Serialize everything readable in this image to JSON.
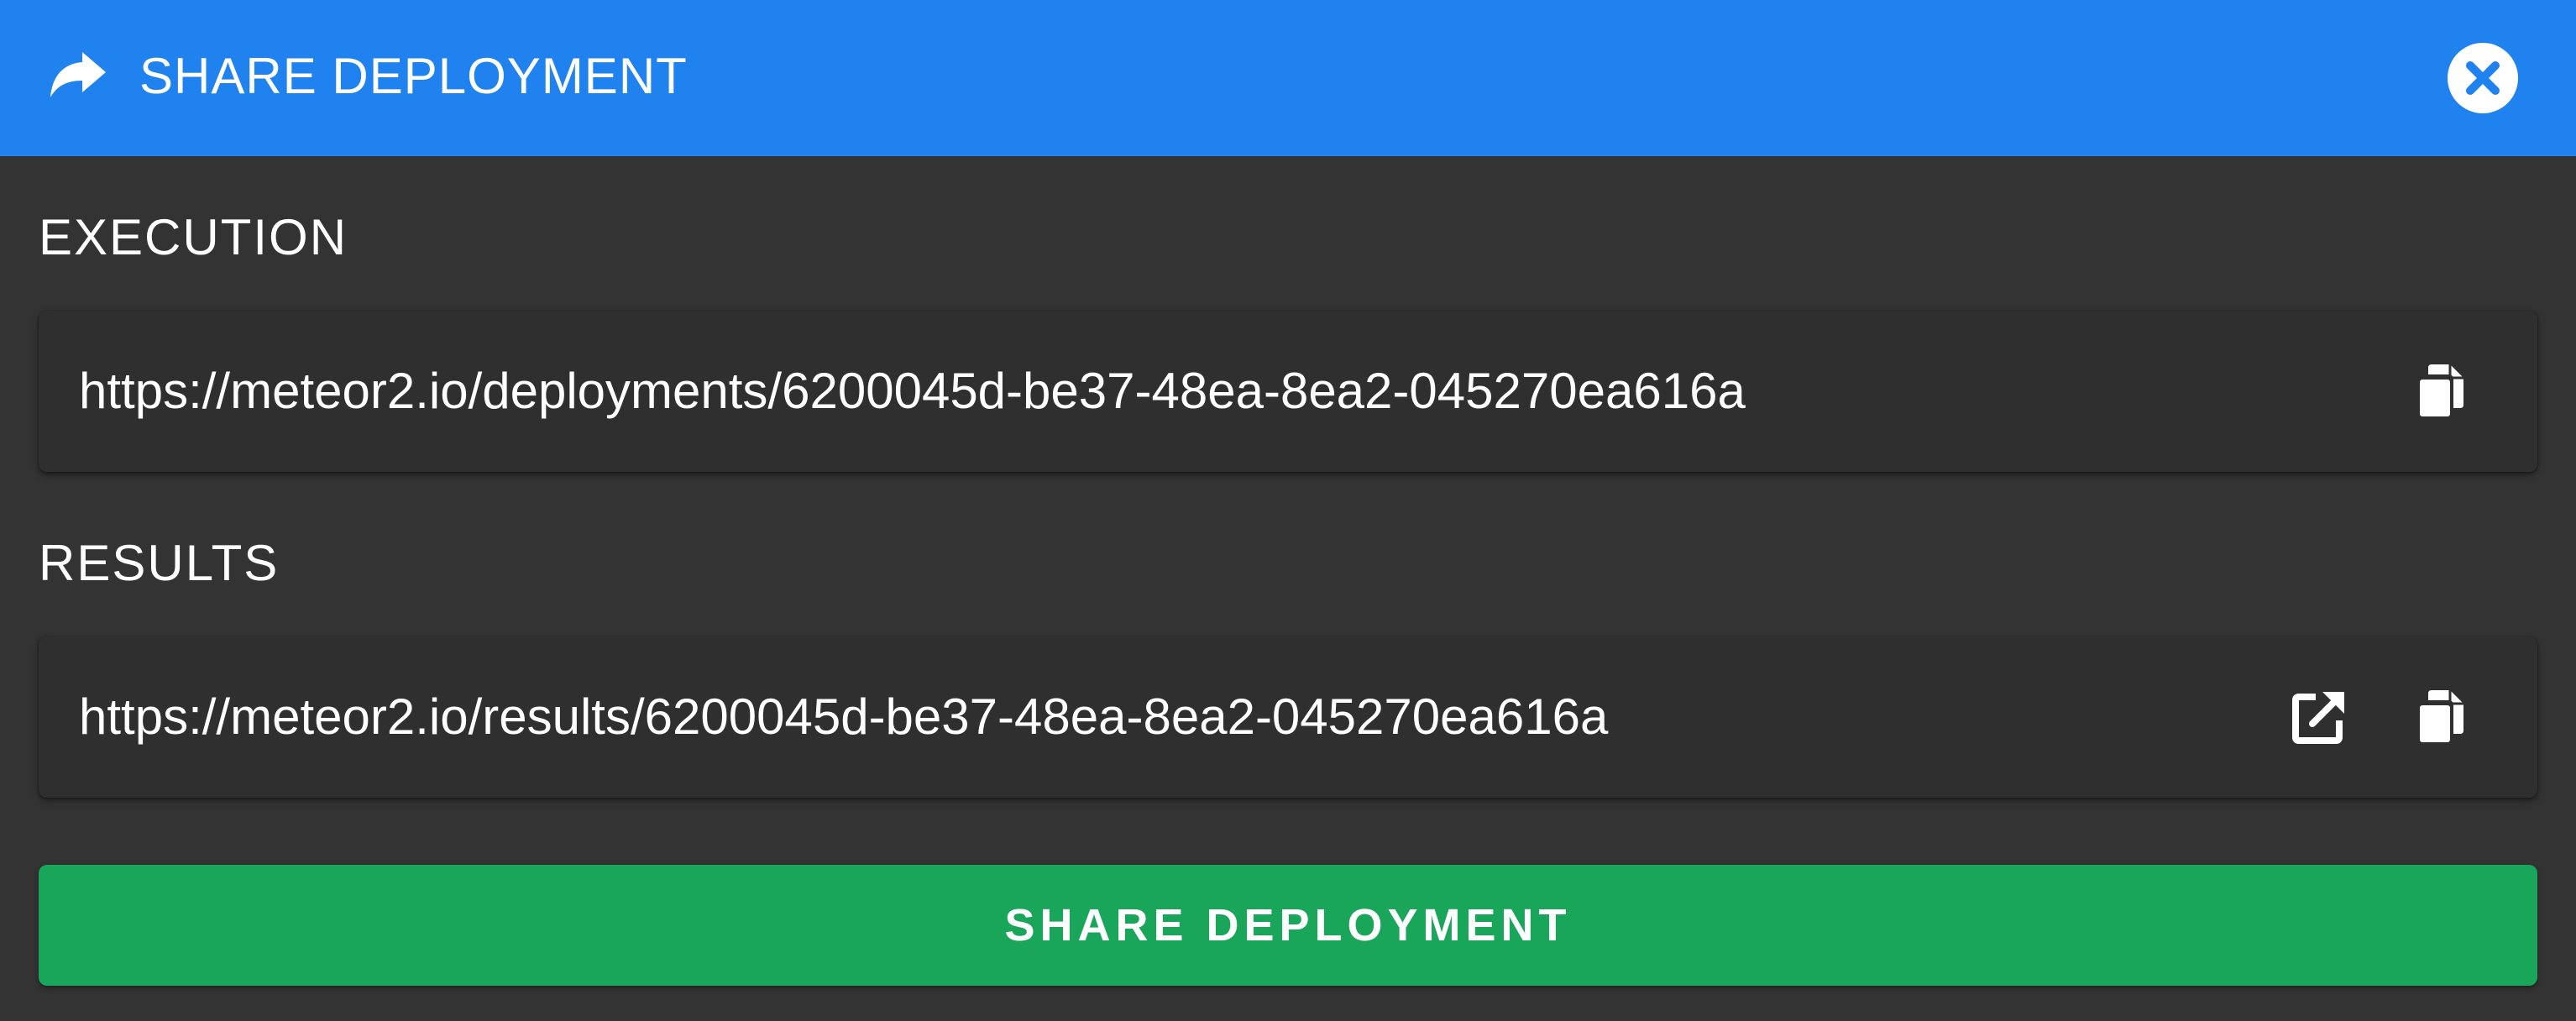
{
  "header": {
    "title": "SHARE DEPLOYMENT",
    "color": "#2082ef",
    "icon": "share-forward-icon",
    "close_icon": "close-circle-icon"
  },
  "execution": {
    "label": "EXECUTION",
    "url": "https://meteor2.io/deployments/6200045d-be37-48ea-8ea2-045270ea616a",
    "actions": [
      "copy-icon"
    ]
  },
  "results": {
    "label": "RESULTS",
    "url": "https://meteor2.io/results/6200045d-be37-48ea-8ea2-045270ea616a",
    "actions": [
      "open-external-icon",
      "copy-icon"
    ]
  },
  "footer": {
    "button_label": "SHARE DEPLOYMENT",
    "button_color": "#19a55a"
  },
  "colors": {
    "background": "#333333",
    "card": "#2f2f2f",
    "text": "#ffffff"
  }
}
